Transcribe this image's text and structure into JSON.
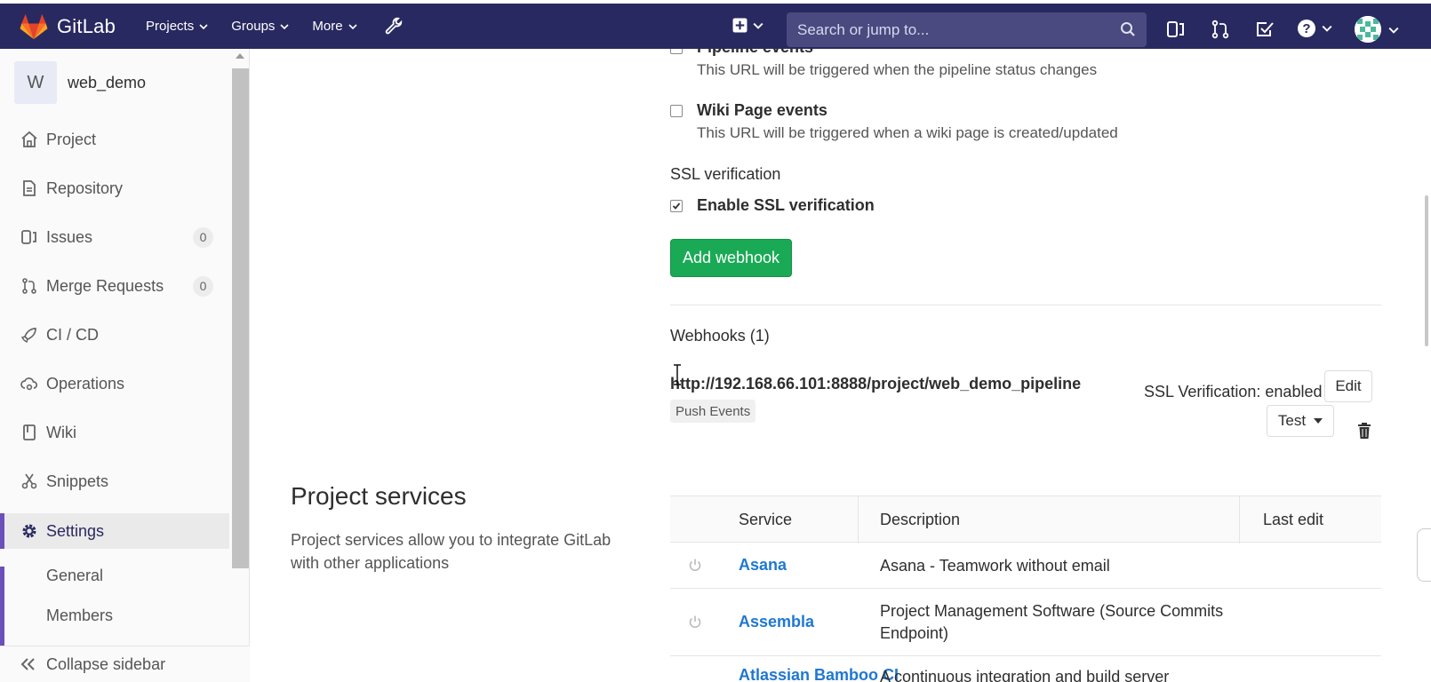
{
  "navbar": {
    "brand": "GitLab",
    "menu": [
      {
        "label": "Projects"
      },
      {
        "label": "Groups"
      },
      {
        "label": "More"
      }
    ],
    "search_placeholder": "Search or jump to..."
  },
  "sidebar": {
    "project_initial": "W",
    "project_name": "web_demo",
    "items": [
      {
        "label": "Project",
        "icon": "home-icon"
      },
      {
        "label": "Repository",
        "icon": "document-icon"
      },
      {
        "label": "Issues",
        "icon": "issues-icon",
        "count": "0"
      },
      {
        "label": "Merge Requests",
        "icon": "merge-request-icon",
        "count": "0"
      },
      {
        "label": "CI / CD",
        "icon": "rocket-icon"
      },
      {
        "label": "Operations",
        "icon": "cloud-gear-icon"
      },
      {
        "label": "Wiki",
        "icon": "book-icon"
      },
      {
        "label": "Snippets",
        "icon": "scissors-icon"
      },
      {
        "label": "Settings",
        "icon": "gear-icon",
        "active": true
      }
    ],
    "subitems": [
      {
        "label": "General"
      },
      {
        "label": "Members"
      }
    ],
    "collapse_label": "Collapse sidebar"
  },
  "webhook_form": {
    "pipeline_events_label": "Pipeline events",
    "pipeline_events_help": "This URL will be triggered when the pipeline status changes",
    "wiki_events_label": "Wiki Page events",
    "wiki_events_help": "This URL will be triggered when a wiki page is created/updated",
    "wiki_events_checked": false,
    "ssl_section_label": "SSL verification",
    "ssl_checkbox_label": "Enable SSL verification",
    "ssl_checked": true,
    "add_button_label": "Add webhook"
  },
  "webhooks": {
    "title": "Webhooks (1)",
    "items": [
      {
        "url": "http://192.168.66.101:8888/project/web_demo_pipeline",
        "events": [
          "Push Events"
        ],
        "ssl_status": "SSL Verification: enabled",
        "edit_label": "Edit",
        "test_label": "Test"
      }
    ]
  },
  "project_services": {
    "title": "Project services",
    "description": "Project services allow you to integrate GitLab with other applications",
    "columns": [
      "Service",
      "Description",
      "Last edit"
    ],
    "rows": [
      {
        "name": "Asana",
        "description": "Asana - Teamwork without email"
      },
      {
        "name": "Assembla",
        "description": "Project Management Software (Source Commits Endpoint)"
      },
      {
        "name": "Atlassian Bamboo CI",
        "description": "A continuous integration and build server"
      }
    ]
  },
  "colors": {
    "navbar_bg": "#292961",
    "accent": "#6b4fbb",
    "success": "#1aaa55",
    "link": "#1f78d1"
  }
}
